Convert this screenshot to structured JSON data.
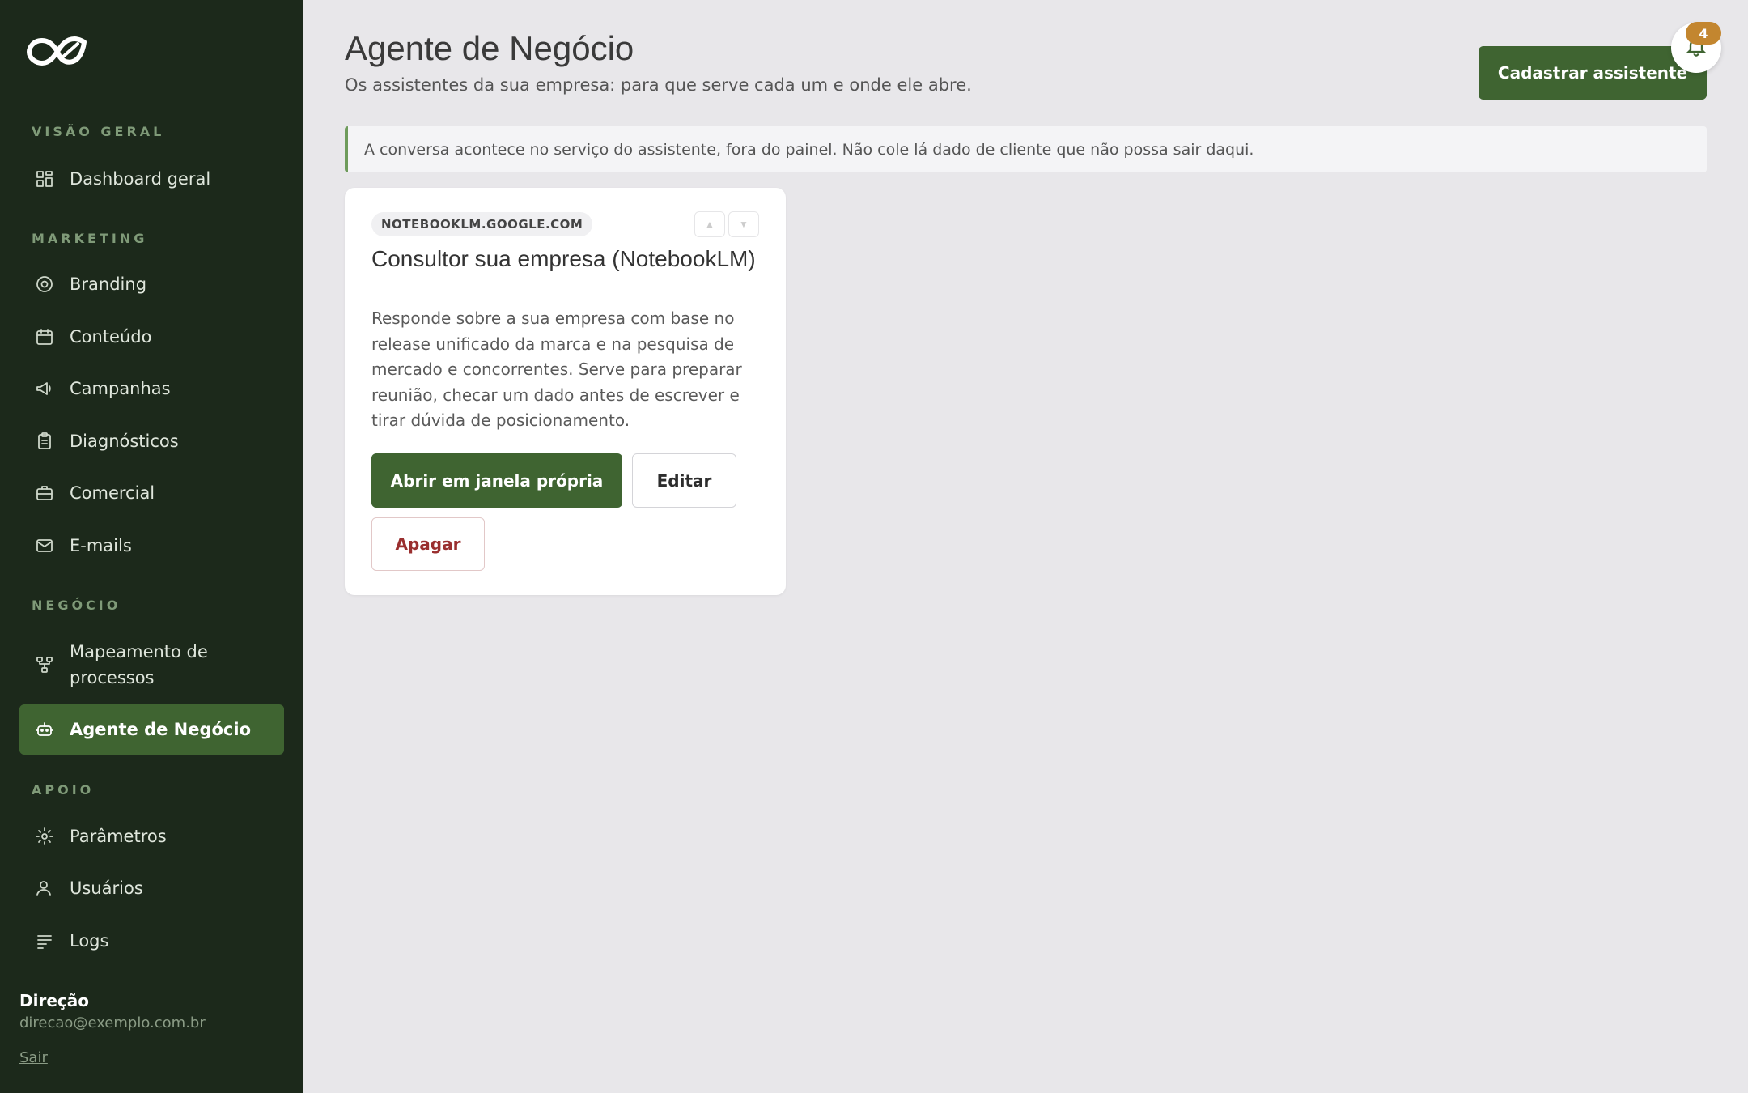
{
  "sidebar": {
    "logo_icon": "infinity-leaf-logo",
    "sections": {
      "overview": "VISÃO GERAL",
      "marketing": "MARKETING",
      "business": "NEGÓCIO",
      "support": "APOIO"
    },
    "items": [
      {
        "label": "Dashboard geral",
        "icon": "grid-icon"
      },
      {
        "label": "Branding",
        "icon": "target-icon"
      },
      {
        "label": "Conteúdo",
        "icon": "calendar-icon"
      },
      {
        "label": "Campanhas",
        "icon": "megaphone-icon"
      },
      {
        "label": "Diagnósticos",
        "icon": "clipboard-icon"
      },
      {
        "label": "Comercial",
        "icon": "briefcase-icon"
      },
      {
        "label": "E-mails",
        "icon": "mail-icon"
      },
      {
        "label": "Mapeamento de processos",
        "icon": "flow-icon"
      },
      {
        "label": "Agente de Negócio",
        "icon": "bot-icon",
        "active": true
      },
      {
        "label": "Parâmetros",
        "icon": "gear-icon"
      },
      {
        "label": "Usuários",
        "icon": "user-icon"
      },
      {
        "label": "Logs",
        "icon": "list-icon"
      }
    ],
    "user": {
      "name": "Direção",
      "email": "direcao@exemplo.com.br",
      "logout": "Sair"
    }
  },
  "header": {
    "title": "Agente de Negócio",
    "subtitle": "Os assistentes da sua empresa: para que serve cada um e onde ele abre.",
    "primary_button": "Cadastrar assistente",
    "notifications_count": "4"
  },
  "notice": "A conversa acontece no serviço do assistente, fora do painel. Não cole lá dado de cliente que não possa sair daqui.",
  "assistants": [
    {
      "domain": "NOTEBOOKLM.GOOGLE.COM",
      "title": "Consultor sua empresa (NotebookLM)",
      "description": "Responde sobre a sua empresa com base no release unificado da marca e na pesquisa de mercado e concorrentes. Serve para preparar reunião, checar um dado antes de escrever e tirar dúvida de posicionamento.",
      "open_label": "Abrir em janela própria",
      "edit_label": "Editar",
      "delete_label": "Apagar",
      "move_up": "▲",
      "move_down": "▼"
    }
  ],
  "colors": {
    "sidebar_bg": "#1c291b",
    "accent": "#3f6431",
    "badge": "#c3862f",
    "danger": "#9a2f2f",
    "page_bg": "#e8e7ea"
  }
}
